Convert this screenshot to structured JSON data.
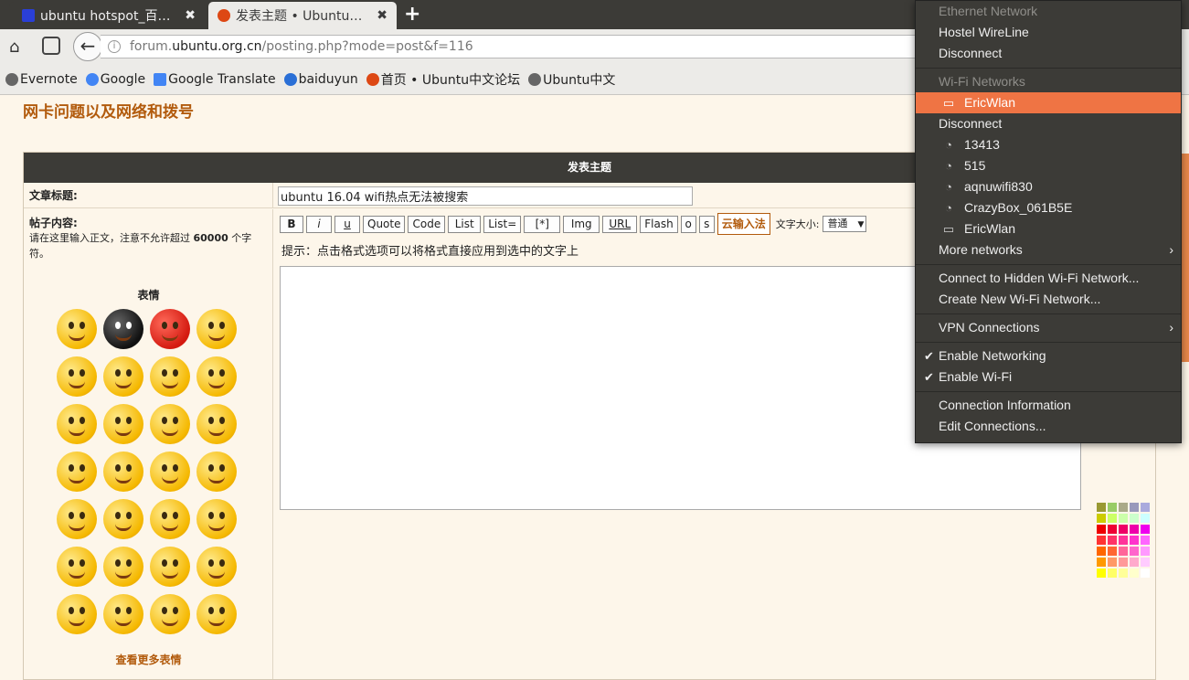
{
  "browser": {
    "tabs": [
      {
        "title": "ubuntu hotspot_百…",
        "active": false
      },
      {
        "title": "发表主题 • Ubuntu…",
        "active": true
      }
    ],
    "tab_close": "✖",
    "new_tab": "+",
    "url": {
      "prefix": "forum.",
      "domain": "ubuntu.org.cn",
      "path": "/posting.php?mode=post&f=116"
    },
    "bookmarks": [
      "Evernote",
      "Google",
      "Google Translate",
      "baiduyun",
      "首页 • Ubuntu中文论坛",
      "Ubuntu中文"
    ],
    "bookmark_colors": [
      "#666666",
      "#4285f4",
      "#4285f4",
      "#2a6fd6",
      "#dd4814",
      "#666666"
    ]
  },
  "forum": {
    "section_title": "网卡问题以及网络和拨号",
    "form_header": "发表主题",
    "subject_label": "文章标题:",
    "subject_value": "ubuntu 16.04 wifi热点无法被搜索",
    "content_label": "帖子内容:",
    "content_note_prefix": "请在这里输入正文，注意不允许超过",
    "content_note_limit": "60000",
    "content_note_suffix": "个字符。",
    "smilies_title": "表情",
    "more_smilies": "查看更多表情",
    "toolbar": {
      "bold": "B",
      "italic": "i",
      "underline": "u",
      "quote": "Quote",
      "code": "Code",
      "list": "List",
      "list_eq": "List=",
      "list_item": "[*]",
      "img": "Img",
      "url": "URL",
      "flash": "Flash",
      "o": "o",
      "s": "s",
      "ime": "云输入法",
      "font_size_label": "文字大小:",
      "font_size_value": "普通"
    },
    "hint": "提示：点击格式选项可以将格式直接应用到选中的文字上"
  },
  "network_menu": {
    "ethernet_header": "Ethernet Network",
    "ethernet_item": "Hostel WireLine",
    "ethernet_disconnect": "Disconnect",
    "wifi_header": "Wi-Fi Networks",
    "connected": "EricWlan",
    "wifi_disconnect": "Disconnect",
    "networks": [
      "13413",
      "515",
      "aqnuwifi830",
      "CrazyBox_061B5E",
      "EricWlan"
    ],
    "more_networks": "More networks",
    "hidden": "Connect to Hidden Wi-Fi Network...",
    "create": "Create New Wi-Fi Network...",
    "vpn": "VPN Connections",
    "enable_networking": "Enable Networking",
    "enable_wifi": "Enable Wi-Fi",
    "info": "Connection Information",
    "edit": "Edit Connections...",
    "accent_color": "#ef7444"
  }
}
